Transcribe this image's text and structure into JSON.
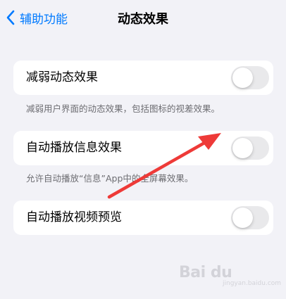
{
  "nav": {
    "back_label": "辅助功能",
    "title": "动态效果"
  },
  "settings": [
    {
      "label": "减弱动态效果",
      "toggle_on": false,
      "footnote": "减弱用户界面的动态效果，包括图标的视差效果。"
    },
    {
      "label": "自动播放信息效果",
      "toggle_on": false,
      "footnote": "允许自动播放“信息”App中的全屏幕效果。"
    },
    {
      "label": "自动播放视频预览",
      "toggle_on": false,
      "footnote": ""
    }
  ],
  "annotation": {
    "arrow_color": "#ee3a38"
  },
  "watermark": {
    "logo": "Bai du",
    "sub": "jingyan.baidu.com"
  },
  "colors": {
    "background": "#f2f2f7",
    "accent": "#007aff",
    "toggle_off": "#e9e9eb"
  }
}
